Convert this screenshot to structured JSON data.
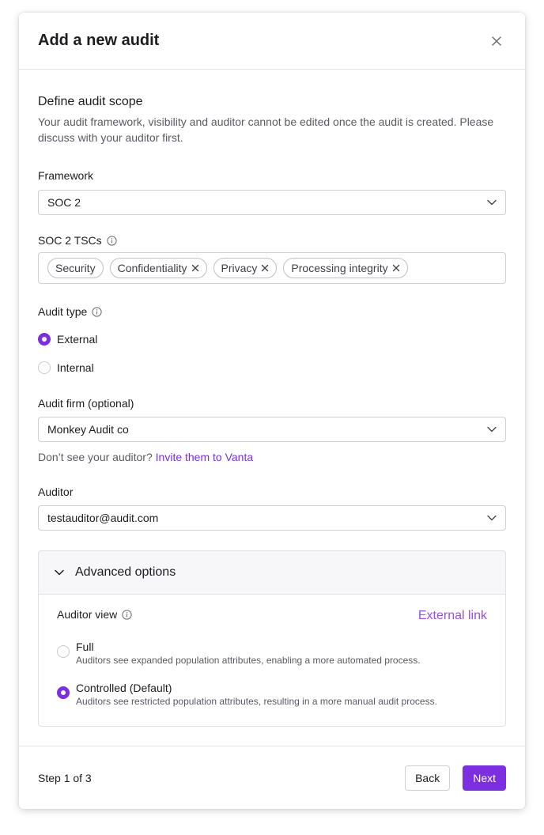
{
  "modal": {
    "title": "Add a new audit"
  },
  "scope": {
    "title": "Define audit scope",
    "description": "Your audit framework, visibility and auditor cannot be edited once the audit is created. Please discuss with your auditor first."
  },
  "framework": {
    "label": "Framework",
    "value": "SOC 2"
  },
  "tscs": {
    "label": "SOC 2 TSCs",
    "tags": [
      "Security",
      "Confidentiality",
      "Privacy",
      "Processing integrity"
    ]
  },
  "audit_type": {
    "label": "Audit type",
    "options": [
      "External",
      "Internal"
    ],
    "selected": "External"
  },
  "audit_firm": {
    "label": "Audit firm (optional)",
    "value": "Monkey Audit co",
    "helper_text": "Don’t see your auditor?",
    "helper_link": "Invite them to Vanta"
  },
  "auditor": {
    "label": "Auditor",
    "value": "testauditor@audit.com"
  },
  "advanced": {
    "title": "Advanced options",
    "auditor_view_label": "Auditor view",
    "external_link": "External link",
    "options": [
      {
        "title": "Full",
        "description": "Auditors see expanded population attributes, enabling a more automated process."
      },
      {
        "title": "Controlled (Default)",
        "description": "Auditors see restricted population attributes, resulting in a more manual audit process."
      }
    ],
    "selected": "Controlled (Default)"
  },
  "footer": {
    "step": "Step 1 of 3",
    "back_label": "Back",
    "next_label": "Next"
  },
  "colors": {
    "accent": "#7b2fe0",
    "link": "#9b4fe0"
  }
}
